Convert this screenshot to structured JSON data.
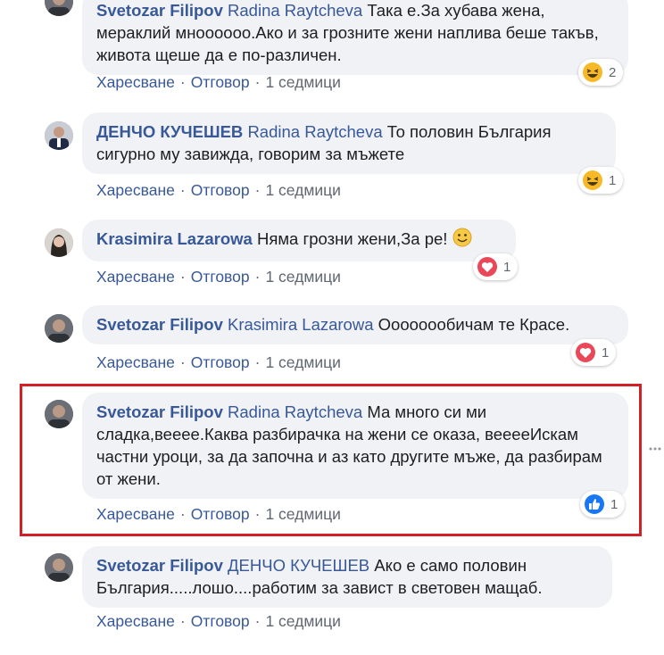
{
  "comments": [
    {
      "author": "Svetozar Filipov",
      "mention": "Radina Raytcheva",
      "text": "Така е.За хубава жена, мераклий мноооооо.Ако и за грозните жени наплива беше такъв, живота щеше да е по-различен.",
      "like": "Харесване",
      "reply": "Отговор",
      "time": "1 седмици",
      "reaction": "haha",
      "reaction_count": "2"
    },
    {
      "author": "ДЕНЧО КУЧЕШЕВ",
      "mention": "Radina Raytcheva",
      "text": "То половин България сигурно му завижда, говорим за мъжете",
      "like": "Харесване",
      "reply": "Отговор",
      "time": "1 седмици",
      "reaction": "haha",
      "reaction_count": "1"
    },
    {
      "author": "Krasimira Lazarowa",
      "mention": "",
      "text": "Няма грозни жени,За ре!",
      "like": "Харесване",
      "reply": "Отговор",
      "time": "1 седмици",
      "reaction": "love",
      "reaction_count": "1"
    },
    {
      "author": "Svetozar Filipov",
      "mention": "Krasimira Lazarowa",
      "text": "Оооооообичам те Красе.",
      "like": "Харесване",
      "reply": "Отговор",
      "time": "1 седмици",
      "reaction": "love",
      "reaction_count": "1"
    },
    {
      "author": "Svetozar Filipov",
      "mention": "Radina Raytcheva",
      "text": "Ма много си ми сладка,веееe.Каква разбирачка на жени се оказа, веееeИскам частни уроци, за да започна и аз като другите мъже, да разбирам от жени.",
      "like": "Харесване",
      "reply": "Отговор",
      "time": "1 седмици",
      "reaction": "like",
      "reaction_count": "1"
    },
    {
      "author": "Svetozar Filipov",
      "mention": "ДЕНЧО КУЧЕШЕВ",
      "text": "Ако е само половин България.....лошо....работим за завист в световен мащаб.",
      "like": "Харесване",
      "reply": "Отговор",
      "time": "1 седмици",
      "reaction": "",
      "reaction_count": ""
    }
  ],
  "colors": {
    "link": "#385898",
    "muted": "#606770",
    "bubble": "#f0f2f5",
    "highlight": "#d32027"
  }
}
